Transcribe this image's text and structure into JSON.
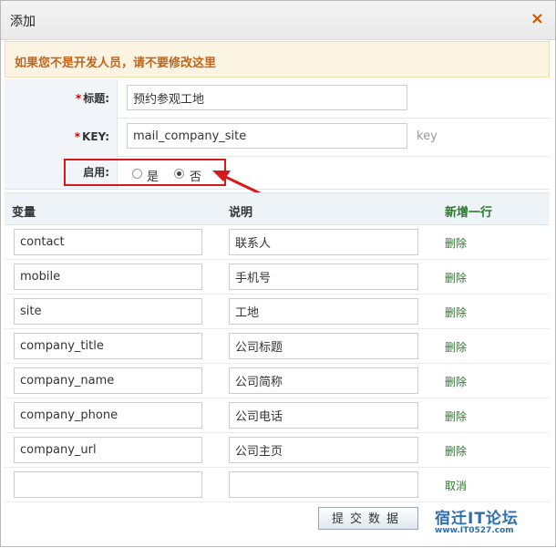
{
  "dialog": {
    "title": "添加",
    "close_glyph": "×"
  },
  "warning": "如果您不是开发人员，请不要修改这里",
  "form": {
    "title_field": {
      "required_mark": "*",
      "label": "标题:",
      "value": "预约参观工地"
    },
    "key_field": {
      "required_mark": "*",
      "label": "KEY:",
      "value": "mail_company_site",
      "hint": "key"
    },
    "enable_field": {
      "label": "启用:",
      "options": [
        {
          "label": "是",
          "checked": false
        },
        {
          "label": "否",
          "checked": true
        }
      ]
    }
  },
  "table": {
    "headers": {
      "variable": "变量",
      "description": "说明",
      "add_row": "新增一行"
    },
    "rows": [
      {
        "variable": "contact",
        "description": "联系人",
        "action": "删除"
      },
      {
        "variable": "mobile",
        "description": "手机号",
        "action": "删除"
      },
      {
        "variable": "site",
        "description": "工地",
        "action": "删除"
      },
      {
        "variable": "company_title",
        "description": "公司标题",
        "action": "删除"
      },
      {
        "variable": "company_name",
        "description": "公司简称",
        "action": "删除"
      },
      {
        "variable": "company_phone",
        "description": "公司电话",
        "action": "删除"
      },
      {
        "variable": "company_url",
        "description": "公司主页",
        "action": "删除"
      },
      {
        "variable": "",
        "description": "",
        "action": "取消"
      }
    ]
  },
  "submit_label": "提交数据",
  "watermark": {
    "title": "宿迁IT论坛",
    "url": "www.IT0527.com"
  },
  "colors": {
    "annotation": "#d9181a",
    "warning_text": "#c0651a",
    "link_green": "#2a7a2a"
  },
  "icons": {
    "close": "close-icon",
    "radio": "radio-icon",
    "annotation_arrow": "arrow-icon"
  }
}
